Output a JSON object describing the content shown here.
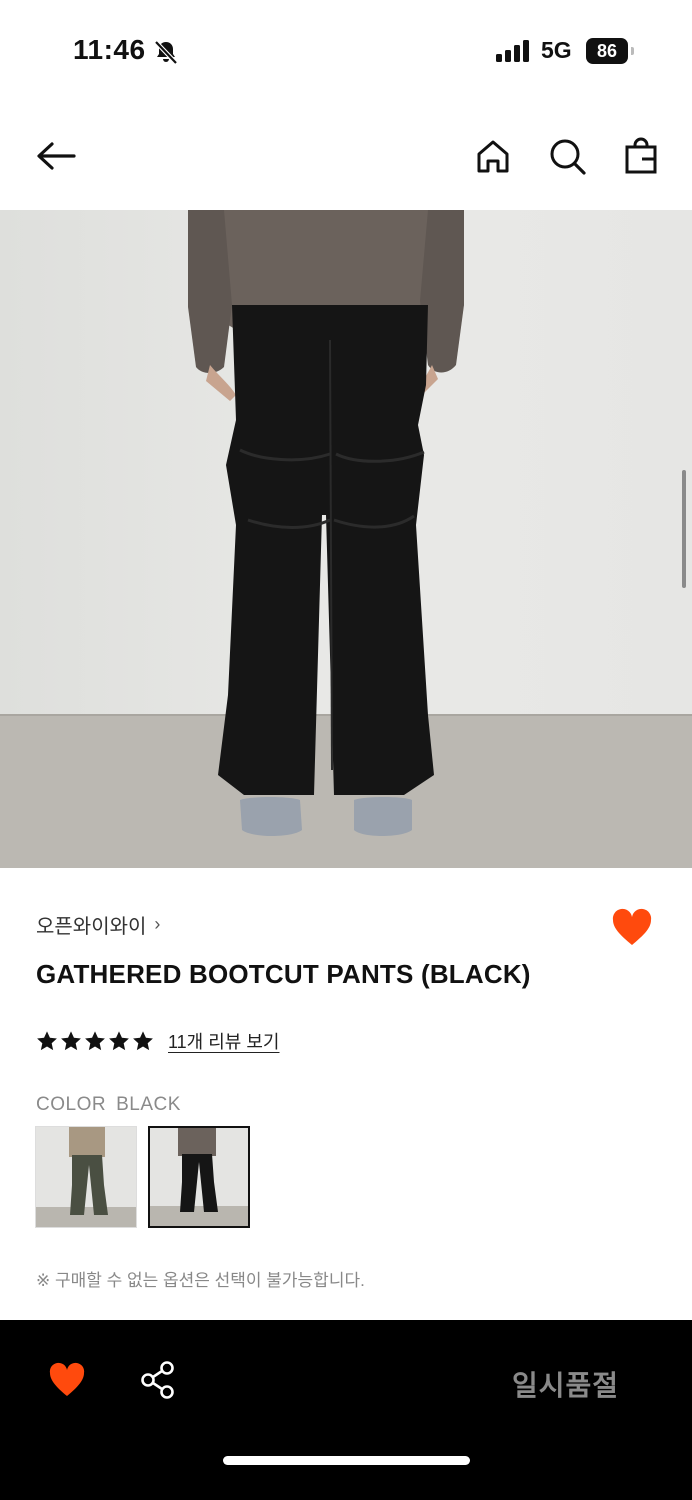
{
  "status_bar": {
    "time": "11:46",
    "network": "5G",
    "battery": "86",
    "icons": [
      "bell-slash-icon",
      "signal-icon",
      "battery-icon"
    ]
  },
  "nav": {
    "icons": [
      "arrow-left-icon",
      "home-icon",
      "search-icon",
      "shopping-bag-icon"
    ]
  },
  "product": {
    "brand": "오픈와이와이",
    "brand_chevron": "›",
    "title": "GATHERED BOOTCUT PANTS (BLACK)",
    "rating_stars": 5,
    "review_link": "11개 리뷰 보기",
    "color_label": "COLOR",
    "color_value": "BLACK",
    "swatches": [
      "olive-khaki",
      "black"
    ],
    "selected_swatch": "black",
    "notice": "※ 구매할 수 없는 옵션은 선택이 불가능합니다.",
    "favorited": true
  },
  "bottom_bar": {
    "sold_out_label": "일시품절",
    "icons": [
      "heart-icon",
      "share-icon"
    ]
  },
  "colors": {
    "accent": "#ff4a0d",
    "bottom_bar_bg": "#000000",
    "sold_out_text": "#8a8a8a"
  }
}
